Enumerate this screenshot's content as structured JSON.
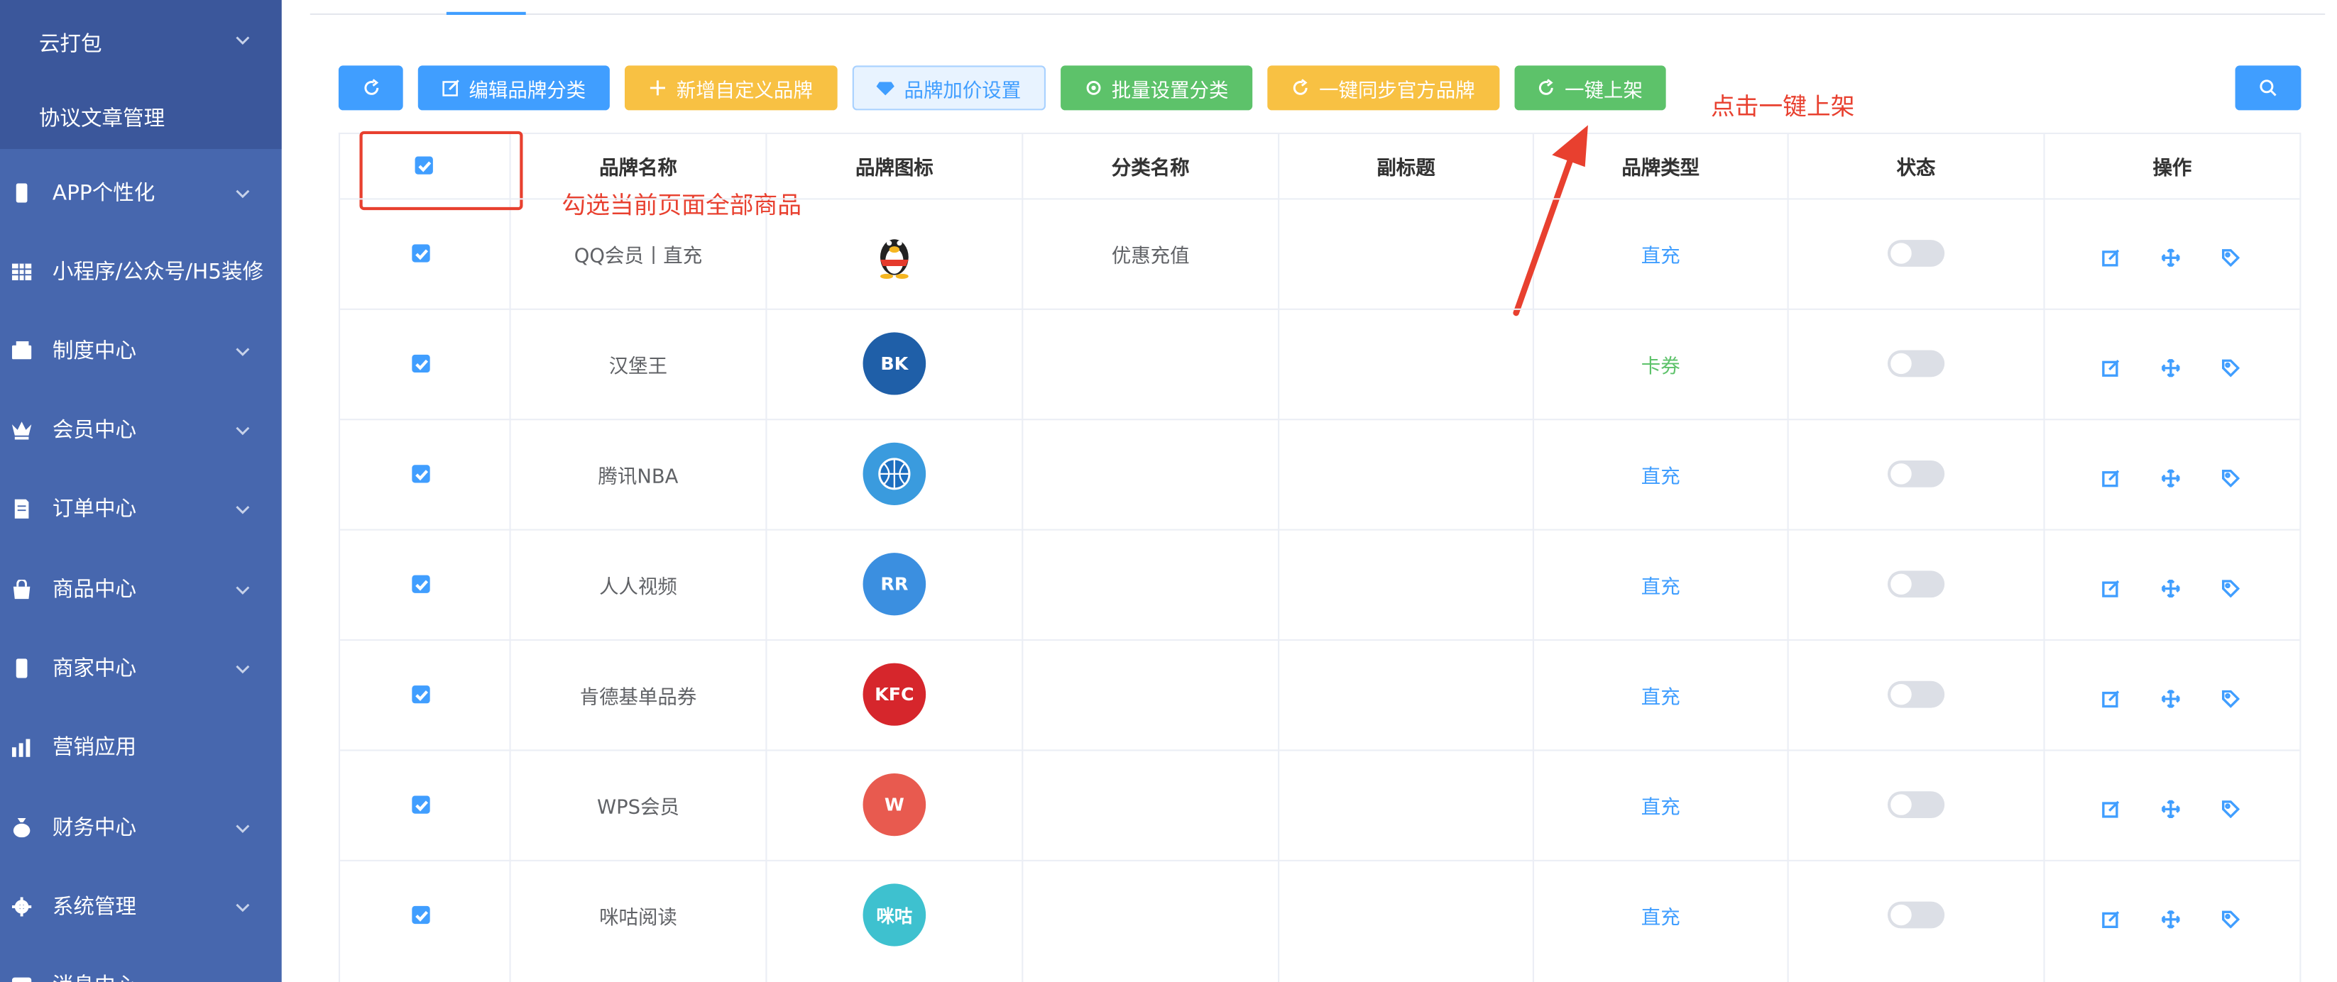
{
  "sidebar": {
    "sub_items": [
      "云打包",
      "协议文章管理"
    ],
    "items": [
      {
        "label": "APP个性化",
        "icon": "phone-icon",
        "chevron": true
      },
      {
        "label": "小程序/公众号/H5装修",
        "icon": "grid-icon",
        "chevron": false
      },
      {
        "label": "制度中心",
        "icon": "wallet-icon",
        "chevron": true
      },
      {
        "label": "会员中心",
        "icon": "crown-icon",
        "chevron": true
      },
      {
        "label": "订单中心",
        "icon": "document-icon",
        "chevron": true
      },
      {
        "label": "商品中心",
        "icon": "bag-icon",
        "chevron": true
      },
      {
        "label": "商家中心",
        "icon": "phone-icon",
        "chevron": true
      },
      {
        "label": "营销应用",
        "icon": "bar-chart-icon",
        "chevron": false
      },
      {
        "label": "财务中心",
        "icon": "money-bag-icon",
        "chevron": true
      },
      {
        "label": "系统管理",
        "icon": "gear-icon",
        "chevron": true
      },
      {
        "label": "消息中心",
        "icon": "message-icon",
        "chevron": true
      }
    ]
  },
  "toolbar": {
    "refresh_label": "",
    "edit_category_label": "编辑品牌分类",
    "add_custom_brand_label": "新增自定义品牌",
    "brand_price_label": "品牌加价设置",
    "batch_category_label": "批量设置分类",
    "sync_official_label": "一键同步官方品牌",
    "list_all_label": "一键上架"
  },
  "table": {
    "headers": [
      "品牌名称",
      "品牌图标",
      "分类名称",
      "副标题",
      "品牌类型",
      "状态",
      "操作"
    ],
    "rows": [
      {
        "name": "QQ会员丨直充",
        "category": "优惠充值",
        "subtitle": "",
        "type": "直充",
        "type_color": "#409eff",
        "logo": "qq-penguin-logo",
        "logo_bg": "#ffffff",
        "logo_text": ""
      },
      {
        "name": "汉堡王",
        "category": "",
        "subtitle": "",
        "type": "卡券",
        "type_color": "#5dc26a",
        "logo": "burger-king-logo",
        "logo_bg": "#1f5fa8",
        "logo_text": "BK"
      },
      {
        "name": "腾讯NBA",
        "category": "",
        "subtitle": "",
        "type": "直充",
        "type_color": "#409eff",
        "logo": "basketball-logo",
        "logo_bg": "#3a9bde",
        "logo_text": ""
      },
      {
        "name": "人人视频",
        "category": "",
        "subtitle": "",
        "type": "直充",
        "type_color": "#409eff",
        "logo": "rr-logo",
        "logo_bg": "#3b8fe0",
        "logo_text": "RR"
      },
      {
        "name": "肯德基单品券",
        "category": "",
        "subtitle": "",
        "type": "直充",
        "type_color": "#409eff",
        "logo": "kfc-logo",
        "logo_bg": "#d6262c",
        "logo_text": "KFC"
      },
      {
        "name": "WPS会员",
        "category": "",
        "subtitle": "",
        "type": "直充",
        "type_color": "#409eff",
        "logo": "wps-logo",
        "logo_bg": "#e85a4f",
        "logo_text": "W"
      },
      {
        "name": "咪咕阅读",
        "category": "",
        "subtitle": "",
        "type": "直充",
        "type_color": "#409eff",
        "logo": "migu-logo",
        "logo_bg": "#3ec1cf",
        "logo_text": "咪咕"
      }
    ]
  },
  "annotations": {
    "select_all_note": "勾选当前页面全部商品",
    "click_note": "点击一键上架",
    "color": "#e8402f"
  }
}
